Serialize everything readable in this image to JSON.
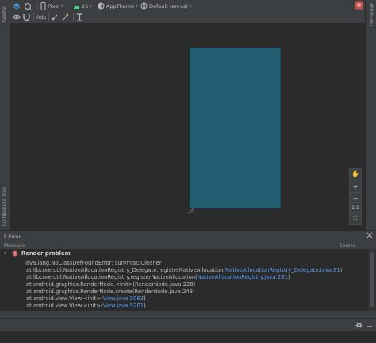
{
  "palette_label": "Palette",
  "component_tree_label": "Component Tree",
  "attributes_label": "Attributes",
  "toolbar": {
    "device": "Pixel",
    "api": "26",
    "theme": "AppTheme",
    "locale": "Default (en-us)",
    "margin": "0dp"
  },
  "zoom": {
    "pan": "✋",
    "zoom_in": "+",
    "zoom_out": "−",
    "actual": "1:1",
    "fit": "⛶"
  },
  "error_panel": {
    "title": "1 Error",
    "col_message": "Message",
    "col_source": "Source",
    "problem_title": "Render problem",
    "lines": [
      {
        "prefix": "java.lang.NoClassDefFoundError: sun/misc/Cleaner",
        "link": "",
        "suffix": ""
      },
      {
        "prefix": "at libcore.util.NativeAllocationRegistry_Delegate.registerNativeAllocation(",
        "link": "NativeAllocationRegistry_Delegate.java:81",
        "suffix": ")"
      },
      {
        "prefix": "at libcore.util.NativeAllocationRegistry.registerNativeAllocation(",
        "link": "NativeAllocationRegistry.java:231",
        "suffix": ")"
      },
      {
        "prefix": "at android.graphics.RenderNode.<init>(RenderNode.java:228)",
        "link": "",
        "suffix": ""
      },
      {
        "prefix": "at android.graphics.RenderNode.create(RenderNode.java:243)",
        "link": "",
        "suffix": ""
      },
      {
        "prefix": "at android.view.View.<init>(",
        "link": "View.java:5063",
        "suffix": ")"
      },
      {
        "prefix": "at android.view.View.<init>(",
        "link": "View.java:5201",
        "suffix": ")"
      }
    ]
  },
  "colors": {
    "device_screen": "#235d72",
    "error_red": "#c75450",
    "link": "#589df6"
  }
}
